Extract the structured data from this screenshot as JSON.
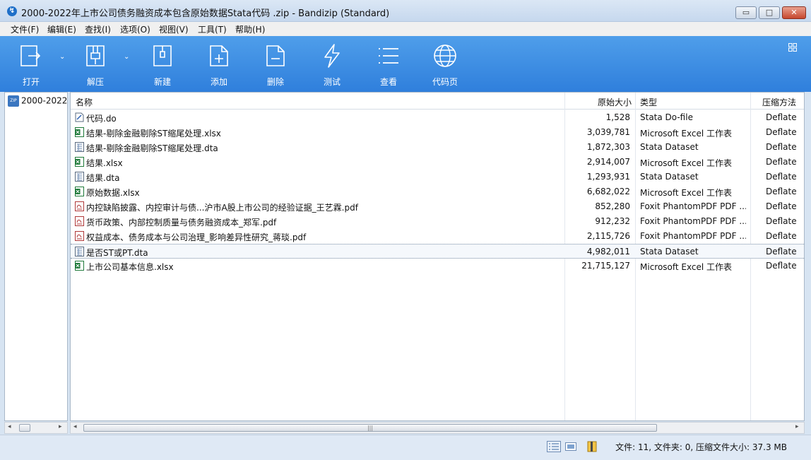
{
  "window": {
    "title": "2000-2022年上市公司债务融资成本包含原始数据Stata代码 .zip - Bandizip (Standard)",
    "app_icon_glyph": "↯",
    "minimize_glyph": "▭",
    "maximize_glyph": "□",
    "close_glyph": "✕"
  },
  "menu": [
    "文件(F)",
    "编辑(E)",
    "查找(I)",
    "选项(O)",
    "视图(V)",
    "工具(T)",
    "帮助(H)"
  ],
  "toolbar": {
    "open": "打开",
    "extract": "解压",
    "new": "新建",
    "add": "添加",
    "delete": "删除",
    "test": "测试",
    "view": "查看",
    "codepage": "代码页",
    "dropdown_glyph": "⌄"
  },
  "tree": {
    "root_label": "2000-2022",
    "zip_icon_text": "ZIP"
  },
  "columns": {
    "name": "名称",
    "size": "原始大小",
    "type": "类型",
    "method": "压缩方法"
  },
  "files": [
    {
      "name": "代码.do",
      "size": "1,528",
      "type": "Stata Do-file",
      "method": "Deflate",
      "icon": "do-file-icon"
    },
    {
      "name": "结果-剔除金融剔除ST缩尾处理.xlsx",
      "size": "3,039,781",
      "type": "Microsoft Excel 工作表",
      "method": "Deflate",
      "icon": "excel-icon"
    },
    {
      "name": "结果-剔除金融剔除ST缩尾处理.dta",
      "size": "1,872,303",
      "type": "Stata Dataset",
      "method": "Deflate",
      "icon": "dta-icon"
    },
    {
      "name": "结果.xlsx",
      "size": "2,914,007",
      "type": "Microsoft Excel 工作表",
      "method": "Deflate",
      "icon": "excel-icon"
    },
    {
      "name": "结果.dta",
      "size": "1,293,931",
      "type": "Stata Dataset",
      "method": "Deflate",
      "icon": "dta-icon"
    },
    {
      "name": "原始数据.xlsx",
      "size": "6,682,022",
      "type": "Microsoft Excel 工作表",
      "method": "Deflate",
      "icon": "excel-icon"
    },
    {
      "name": "内控缺陷披露、内控审计与债...沪市A股上市公司的经验证据_王艺霖.pdf",
      "size": "852,280",
      "type": "Foxit PhantomPDF PDF ...",
      "method": "Deflate",
      "icon": "pdf-icon"
    },
    {
      "name": "货币政策、内部控制质量与债务融资成本_郑军.pdf",
      "size": "912,232",
      "type": "Foxit PhantomPDF PDF ...",
      "method": "Deflate",
      "icon": "pdf-icon"
    },
    {
      "name": "权益成本、债务成本与公司治理_影响差异性研究_蒋琰.pdf",
      "size": "2,115,726",
      "type": "Foxit PhantomPDF PDF ...",
      "method": "Deflate",
      "icon": "pdf-icon"
    },
    {
      "name": "是否ST或PT.dta",
      "size": "4,982,011",
      "type": "Stata Dataset",
      "method": "Deflate",
      "icon": "dta-icon",
      "selected": true
    },
    {
      "name": "上市公司基本信息.xlsx",
      "size": "21,715,127",
      "type": "Microsoft Excel 工作表",
      "method": "Deflate",
      "icon": "excel-icon"
    }
  ],
  "scroll": {
    "left_arrow": "◂",
    "right_arrow": "▸",
    "grip": "|||"
  },
  "status": {
    "text": "文件: 11, 文件夹: 0, 压缩文件大小: 37.3 MB"
  },
  "colors": {
    "toolbar": "#3a8ae4",
    "selection": "#f5f8fc",
    "pdf_icon": "#b03a3a",
    "excel_icon": "#1f7a3a"
  }
}
